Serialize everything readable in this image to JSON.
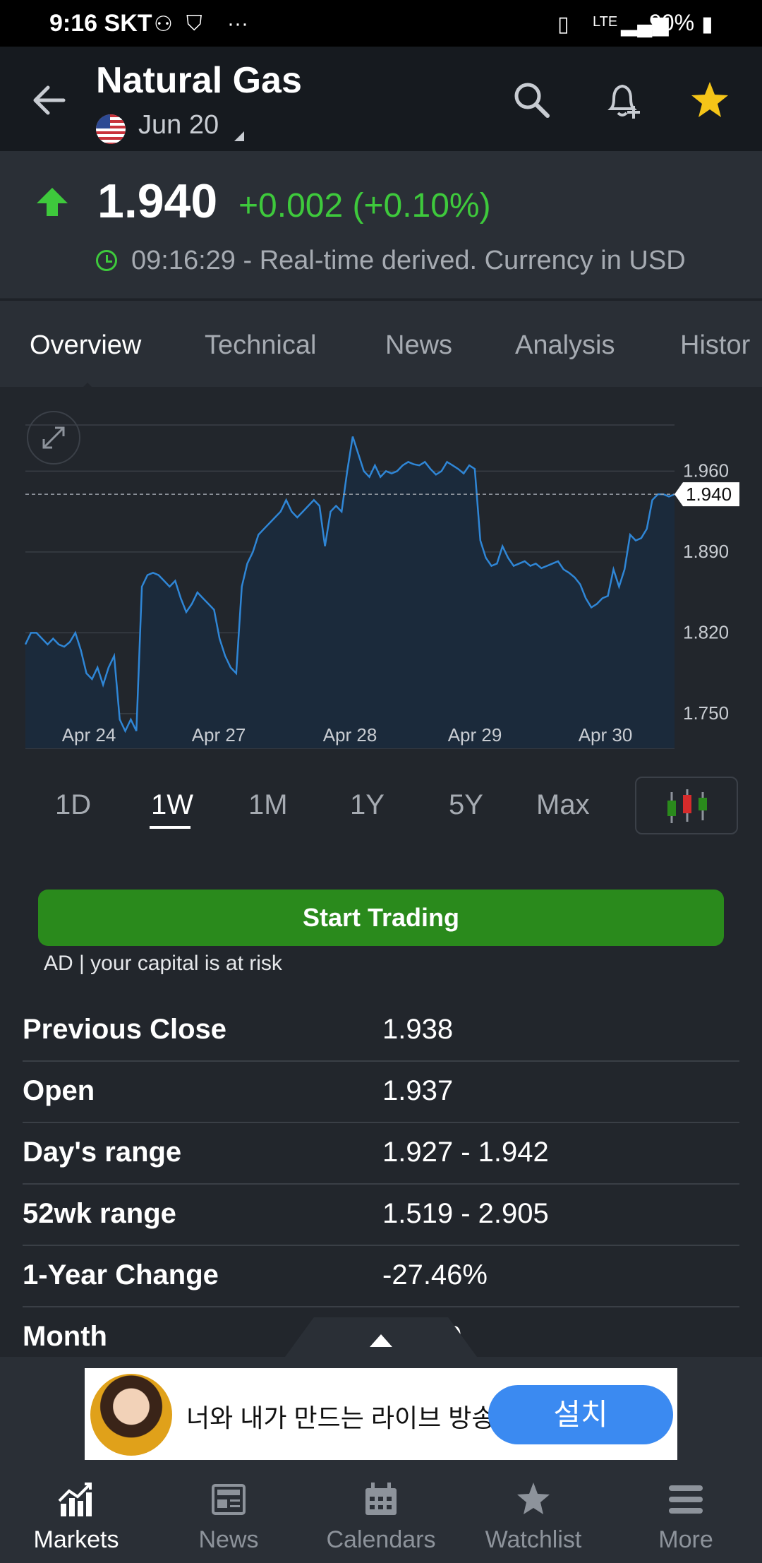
{
  "status_bar": {
    "time": "9:16",
    "carrier": "SKT",
    "battery": "90%",
    "net": "LTE"
  },
  "header": {
    "title": "Natural Gas",
    "expiry": "Jun 20"
  },
  "price": {
    "value": "1.940",
    "change": "+0.002 (+0.10%)",
    "realtime": "09:16:29 - Real-time derived. Currency in USD"
  },
  "tabs": [
    "Overview",
    "Technical",
    "News",
    "Analysis",
    "Histor"
  ],
  "chart_data": {
    "type": "area",
    "x_labels": [
      "Apr 24",
      "Apr 27",
      "Apr 28",
      "Apr 29",
      "Apr 30"
    ],
    "y_ticks": [
      "1.960",
      "1.890",
      "1.820",
      "1.750"
    ],
    "current_label": "1.940",
    "ylim": [
      1.72,
      2.0
    ],
    "values": [
      1.81,
      1.82,
      1.82,
      1.815,
      1.81,
      1.815,
      1.81,
      1.808,
      1.812,
      1.82,
      1.805,
      1.785,
      1.78,
      1.79,
      1.775,
      1.79,
      1.8,
      1.745,
      1.735,
      1.745,
      1.735,
      1.86,
      1.87,
      1.872,
      1.87,
      1.865,
      1.86,
      1.865,
      1.85,
      1.838,
      1.845,
      1.855,
      1.85,
      1.845,
      1.84,
      1.815,
      1.8,
      1.79,
      1.785,
      1.86,
      1.88,
      1.89,
      1.905,
      1.91,
      1.915,
      1.92,
      1.925,
      1.935,
      1.925,
      1.92,
      1.925,
      1.93,
      1.935,
      1.93,
      1.895,
      1.925,
      1.93,
      1.925,
      1.96,
      1.99,
      1.975,
      1.96,
      1.955,
      1.965,
      1.955,
      1.96,
      1.958,
      1.96,
      1.965,
      1.968,
      1.966,
      1.965,
      1.968,
      1.962,
      1.957,
      1.96,
      1.968,
      1.965,
      1.962,
      1.958,
      1.965,
      1.962,
      1.9,
      1.885,
      1.878,
      1.88,
      1.895,
      1.885,
      1.878,
      1.88,
      1.882,
      1.878,
      1.88,
      1.876,
      1.878,
      1.88,
      1.882,
      1.875,
      1.872,
      1.868,
      1.862,
      1.85,
      1.842,
      1.845,
      1.85,
      1.852,
      1.875,
      1.86,
      1.875,
      1.905,
      1.9,
      1.902,
      1.91,
      1.935,
      1.94,
      1.94,
      1.938,
      1.94
    ]
  },
  "ranges": [
    "1D",
    "1W",
    "1M",
    "1Y",
    "5Y",
    "Max"
  ],
  "trading": {
    "button": "Start Trading",
    "disclaimer": "AD | your capital is at risk"
  },
  "stats": [
    {
      "label": "Previous Close",
      "value": "1.938"
    },
    {
      "label": "Open",
      "value": "1.937"
    },
    {
      "label": "Day's range",
      "value": "1.927 - 1.942"
    },
    {
      "label": "52wk range",
      "value": "1.519 - 2.905"
    },
    {
      "label": "1-Year Change",
      "value": "-27.46%"
    },
    {
      "label": "Month",
      "value": "0"
    }
  ],
  "ad": {
    "text": "너와 내가 만드는 라이브 방송",
    "button": "설치"
  },
  "bottom_nav": [
    "Markets",
    "News",
    "Calendars",
    "Watchlist",
    "More"
  ],
  "colors": {
    "up": "#3ec93c",
    "accent_star": "#f5c518",
    "trade": "#2a8a1c",
    "line": "#2f86d6"
  }
}
